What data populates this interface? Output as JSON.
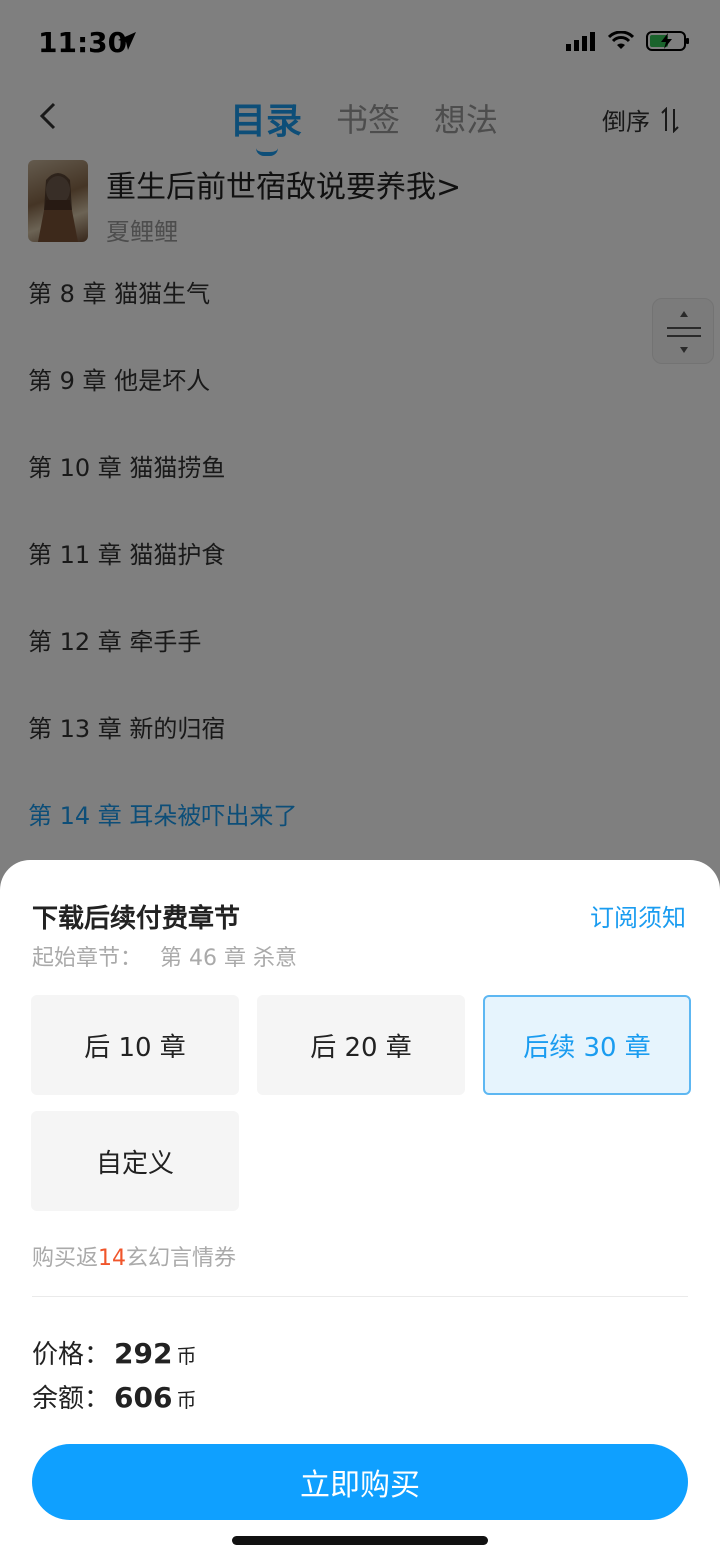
{
  "status": {
    "time": "11:30"
  },
  "nav": {
    "tabs": [
      {
        "label": "目录"
      },
      {
        "label": "书签"
      },
      {
        "label": "想法"
      }
    ],
    "sort_label": "倒序"
  },
  "book": {
    "title": "重生后前世宿敌说要养我>",
    "author": "夏鲤鲤"
  },
  "chapters": [
    {
      "label": "第 8 章  猫猫生气"
    },
    {
      "label": "第 9 章  他是坏人"
    },
    {
      "label": "第 10 章  猫猫捞鱼"
    },
    {
      "label": "第 11 章  猫猫护食"
    },
    {
      "label": "第 12 章  牵手手"
    },
    {
      "label": "第 13 章  新的归宿"
    },
    {
      "label": "第 14 章  耳朵被吓出来了"
    }
  ],
  "current_chapter_color": "#1a9cf0",
  "sheet": {
    "title": "下载后续付费章节",
    "notice_link": "订阅须知",
    "start_label": "起始章节：",
    "start_chapter": "第 46 章 杀意",
    "options": [
      {
        "label": "后 10 章",
        "selected": false
      },
      {
        "label": "后 20 章",
        "selected": false
      },
      {
        "label": "后续 30 章",
        "selected": true
      },
      {
        "label": "自定义",
        "selected": false
      }
    ],
    "rebate": {
      "prefix": "购买返",
      "count": "14",
      "suffix": "玄幻言情券"
    },
    "price": {
      "label": "价格：",
      "value": "292",
      "unit": "币"
    },
    "balance": {
      "label": "余额：",
      "value": "606",
      "unit": "币"
    },
    "buy_label": "立即购买"
  },
  "colors": {
    "accent": "#1a9cf0",
    "buy_button": "#0fa0ff",
    "rebate_number": "#f0552b"
  }
}
